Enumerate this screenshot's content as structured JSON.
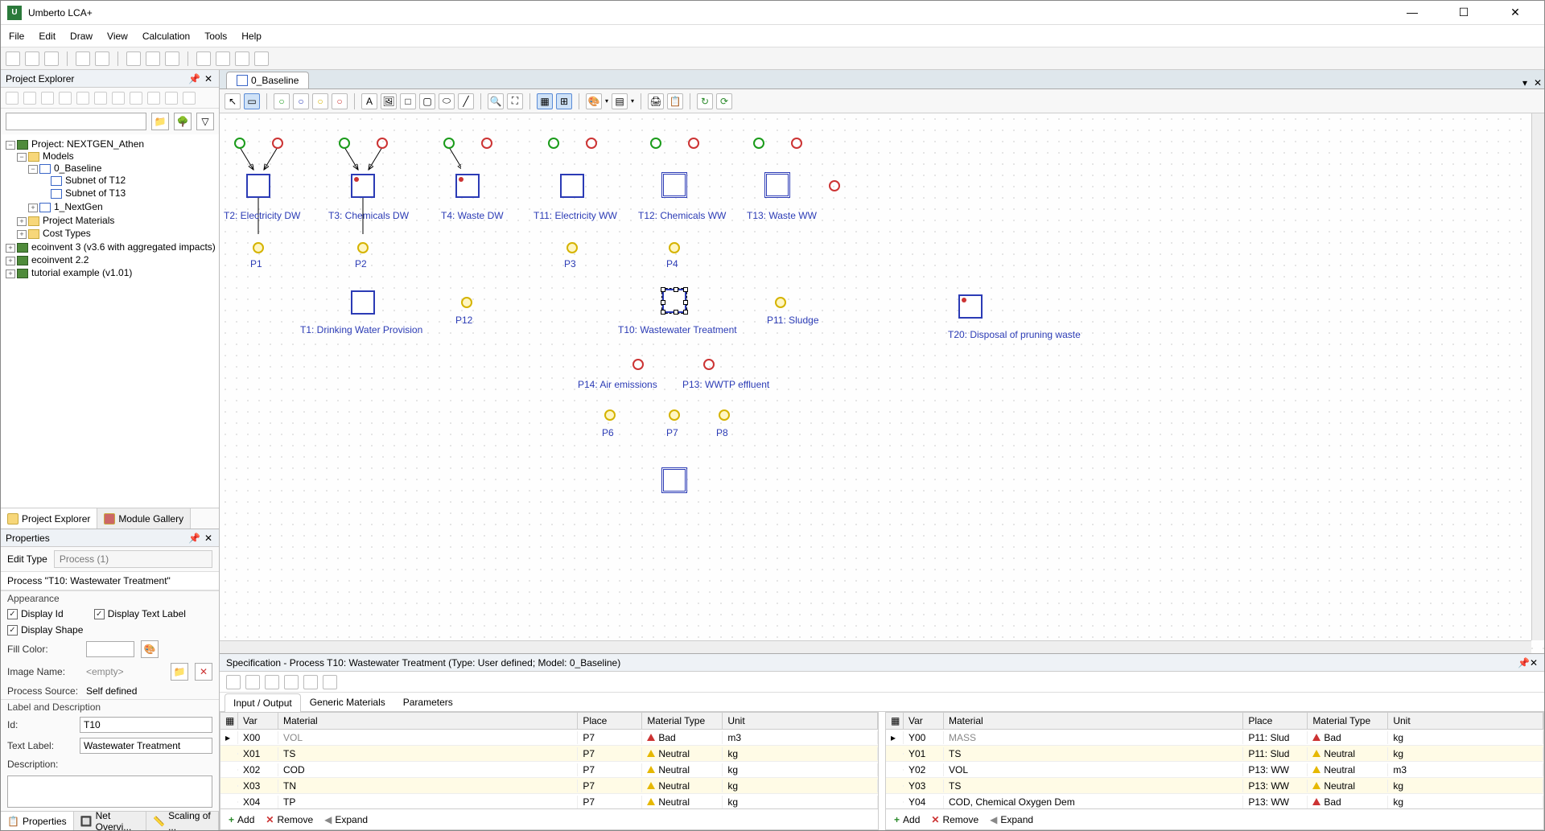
{
  "app": {
    "title": "Umberto LCA+"
  },
  "win_btns": {
    "min": "—",
    "max": "☐",
    "close": "✕"
  },
  "menu": [
    "File",
    "Edit",
    "Draw",
    "View",
    "Calculation",
    "Tools",
    "Help"
  ],
  "project_explorer": {
    "title": "Project Explorer",
    "search_placeholder": "",
    "tree": {
      "root": "Project: NEXTGEN_Athen",
      "models": "Models",
      "baseline": "0_Baseline",
      "sub_t12": "Subnet of T12",
      "sub_t13": "Subnet of T13",
      "nextgen": "1_NextGen",
      "materials": "Project Materials",
      "cost": "Cost Types",
      "eco3": "ecoinvent 3 (v3.6 with aggregated impacts)",
      "eco22": "ecoinvent 2.2",
      "tut": "tutorial example (v1.01)"
    },
    "tabs": {
      "pe": "Project Explorer",
      "mg": "Module Gallery"
    }
  },
  "properties": {
    "title": "Properties",
    "edit_type_label": "Edit Type",
    "edit_type_value": "Process (1)",
    "process_title": "Process \"T10: Wastewater Treatment\"",
    "appearance": "Appearance",
    "display_id": "Display Id",
    "display_text_label": "Display Text Label",
    "display_shape": "Display Shape",
    "fill_color": "Fill Color:",
    "image_name": "Image Name:",
    "image_name_value": "<empty>",
    "process_source": "Process Source:",
    "process_source_value": "Self defined",
    "label_desc": "Label and Description",
    "id_label": "Id:",
    "id_value": "T10",
    "text_label": "Text Label:",
    "text_label_value": "Wastewater Treatment",
    "description": "Description:",
    "bottom_tabs": {
      "props": "Properties",
      "net": "Net Overvi...",
      "scale": "Scaling of ..."
    }
  },
  "doc_tab": {
    "label": "0_Baseline"
  },
  "diagram": {
    "t2": "T2: Electricity DW",
    "t3": "T3: Chemicals DW",
    "t4": "T4: Waste DW",
    "t11": "T11: Electricity WW",
    "t12": "T12: Chemicals WW",
    "t13": "T13: Waste WW",
    "t1": "T1: Drinking Water Provision",
    "t10": "T10: Wastewater Treatment",
    "t20": "T20: Disposal of pruning waste",
    "p1": "P1",
    "p2": "P2",
    "p3": "P3",
    "p4": "P4",
    "p6": "P6",
    "p7": "P7",
    "p8": "P8",
    "p11": "P11: Sludge",
    "p12": "P12",
    "p13": "P13: WWTP effluent",
    "p14": "P14: Air emissions"
  },
  "spec": {
    "title": "Specification - Process T10: Wastewater Treatment (Type: User defined; Model: 0_Baseline)",
    "tabs": {
      "io": "Input / Output",
      "gm": "Generic Materials",
      "params": "Parameters"
    },
    "headers": {
      "var": "Var",
      "material": "Material",
      "place": "Place",
      "mtype": "Material Type",
      "unit": "Unit"
    },
    "footer": {
      "add": "Add",
      "remove": "Remove",
      "expand": "Expand"
    },
    "inputs": [
      {
        "var": "X00",
        "material": "VOL",
        "place": "P7",
        "mtype": "Bad",
        "unit": "m3",
        "active": true
      },
      {
        "var": "X01",
        "material": "TS",
        "place": "P7",
        "mtype": "Neutral",
        "unit": "kg"
      },
      {
        "var": "X02",
        "material": "COD",
        "place": "P7",
        "mtype": "Neutral",
        "unit": "kg"
      },
      {
        "var": "X03",
        "material": "TN",
        "place": "P7",
        "mtype": "Neutral",
        "unit": "kg"
      },
      {
        "var": "X04",
        "material": "TP",
        "place": "P7",
        "mtype": "Neutral",
        "unit": "kg"
      }
    ],
    "outputs": [
      {
        "var": "Y00",
        "material": "MASS",
        "place": "P11: Slud",
        "mtype": "Bad",
        "unit": "kg",
        "active": true
      },
      {
        "var": "Y01",
        "material": "TS",
        "place": "P11: Slud",
        "mtype": "Neutral",
        "unit": "kg"
      },
      {
        "var": "Y02",
        "material": "VOL",
        "place": "P13: WW",
        "mtype": "Neutral",
        "unit": "m3"
      },
      {
        "var": "Y03",
        "material": "TS",
        "place": "P13: WW",
        "mtype": "Neutral",
        "unit": "kg"
      },
      {
        "var": "Y04",
        "material": "COD, Chemical Oxygen Dem",
        "place": "P13: WW",
        "mtype": "Bad",
        "unit": "kg"
      }
    ]
  }
}
